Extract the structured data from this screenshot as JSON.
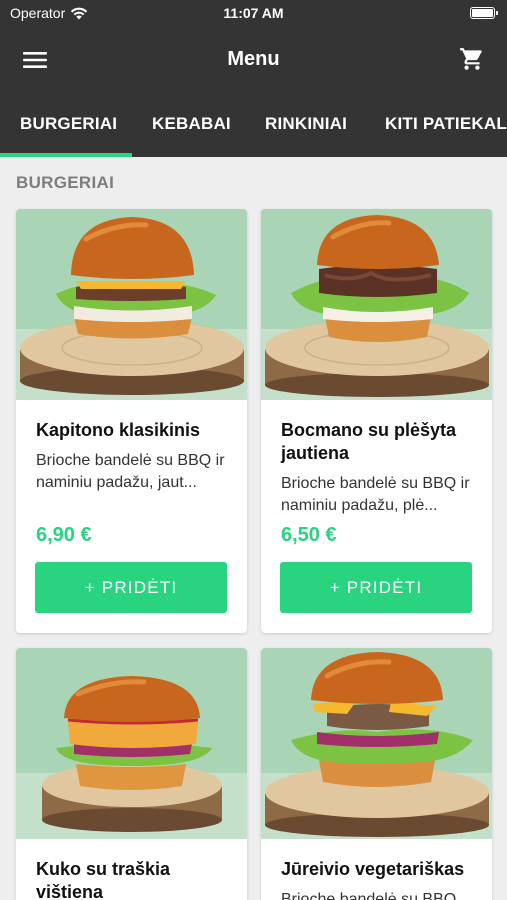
{
  "status_bar": {
    "carrier": "Operator",
    "time": "11:07 AM"
  },
  "header": {
    "title": "Menu",
    "menu_icon": "hamburger-icon",
    "cart_icon": "cart-icon"
  },
  "tabs": [
    {
      "label": "BURGERIAI",
      "active": true
    },
    {
      "label": "KEBABAI",
      "active": false
    },
    {
      "label": "RINKINIAI",
      "active": false
    },
    {
      "label": "KITI PATIEKALAI",
      "active": false
    }
  ],
  "section": {
    "title": "BURGERIAI"
  },
  "colors": {
    "accent": "#29d37f",
    "bar": "#343434",
    "background": "#eeeeee"
  },
  "products": [
    {
      "name": "Kapitono klasikinis",
      "description": "Brioche bandelė su BBQ ir naminiu padažu, jaut...",
      "price": "6,90 €",
      "add_label": "+ PRIDĖTI"
    },
    {
      "name": "Bocmano su plėšyta jautiena",
      "description": "Brioche bandelė su BBQ ir naminiu padažu, plė...",
      "price": "6,50 €",
      "add_label": "+ PRIDĖTI"
    },
    {
      "name": "Kuko su traškia vištiena",
      "description": "",
      "price": "",
      "add_label": ""
    },
    {
      "name": "Jūreivio vegetariškas",
      "description": "Brioche bandelė su BBQ",
      "price": "",
      "add_label": ""
    }
  ]
}
